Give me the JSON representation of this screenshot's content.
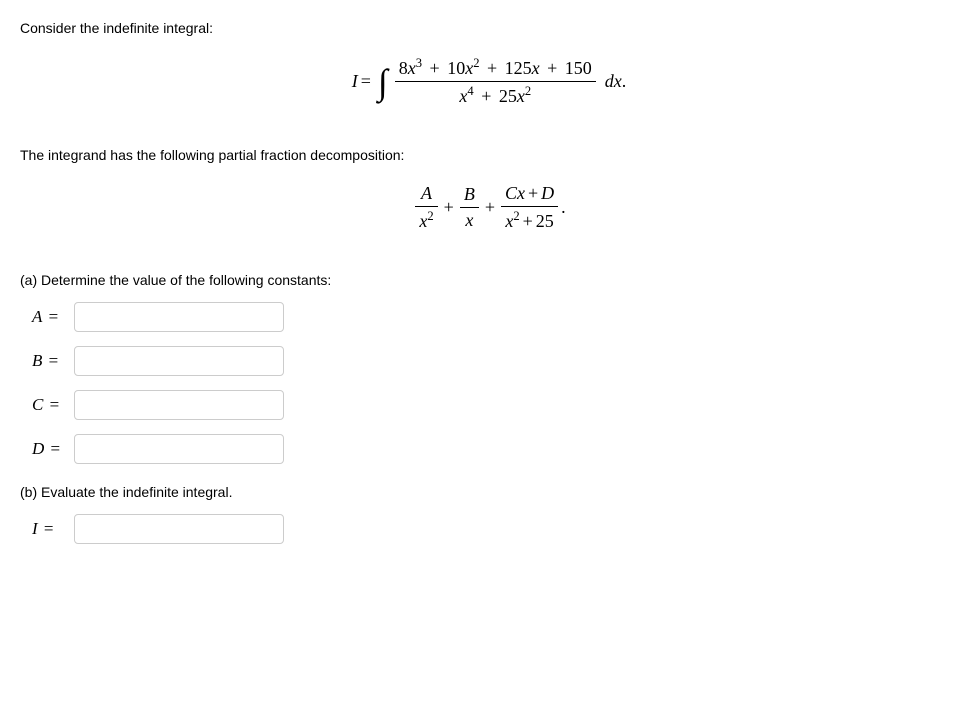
{
  "intro": "Consider the indefinite integral:",
  "integral": {
    "lhs": "I",
    "numerator_tex": "8x^3 + 10x^2 + 125x + 150",
    "denominator_tex": "x^4 + 25x^2",
    "trailer": "dx."
  },
  "decomp_intro": "The integrand has the following partial fraction decomposition:",
  "decomp": {
    "term1_num": "A",
    "term1_den": "x^2",
    "term2_num": "B",
    "term2_den": "x",
    "term3_num": "Cx + D",
    "term3_den": "x^2 + 25"
  },
  "part_a_heading": "(a) Determine the value of the following constants:",
  "inputs": [
    {
      "label": "A",
      "value": ""
    },
    {
      "label": "B",
      "value": ""
    },
    {
      "label": "C",
      "value": ""
    },
    {
      "label": "D",
      "value": ""
    }
  ],
  "part_b_heading": "(b) Evaluate the indefinite integral.",
  "result_label": "I",
  "result_value": ""
}
